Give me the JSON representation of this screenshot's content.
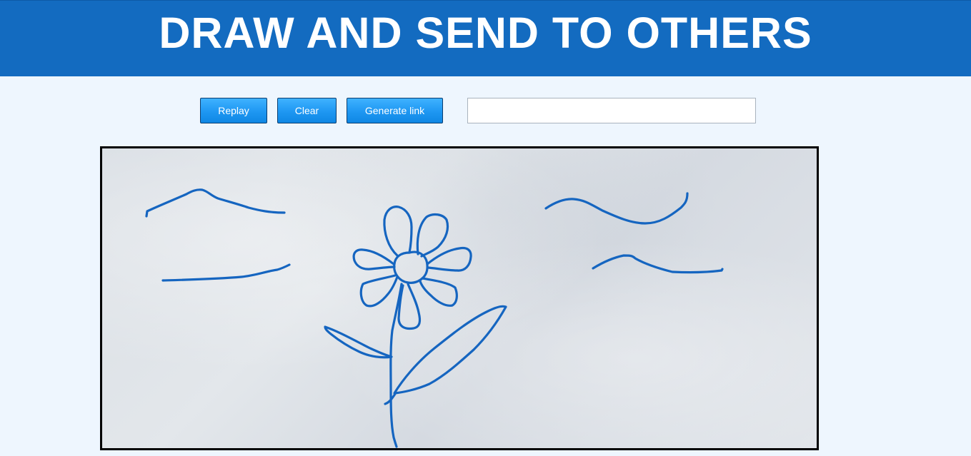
{
  "header": {
    "title": "DRAW AND SEND TO OTHERS"
  },
  "toolbar": {
    "replay_label": "Replay",
    "clear_label": "Clear",
    "generate_label": "Generate link",
    "link_value": ""
  },
  "drawing": {
    "stroke_color": "#1565c0",
    "strokes": [
      "hill-left",
      "ground-line-left",
      "hill-right",
      "line-right",
      "flower-center",
      "petals",
      "stem",
      "leaf-left",
      "leaf-right"
    ]
  },
  "colors": {
    "header_bg": "#136bc0",
    "page_bg": "#eef6fe",
    "button_bg": "#1e97f2",
    "stroke": "#1565c0"
  }
}
